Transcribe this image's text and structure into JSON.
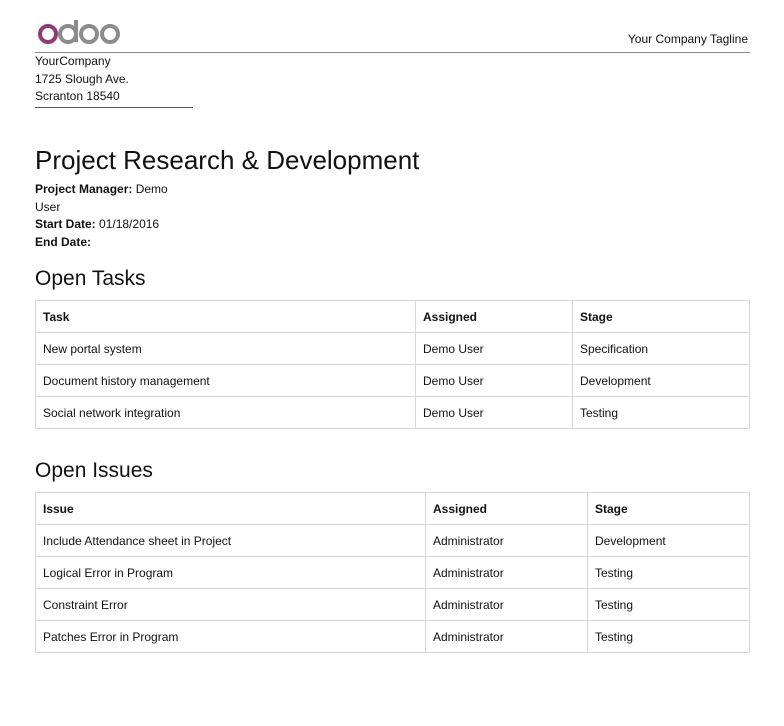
{
  "header": {
    "logo_text": "odoo",
    "tagline": "Your Company Tagline"
  },
  "company": {
    "name": "YourCompany",
    "street": "1725 Slough Ave.",
    "city_zip": "Scranton 18540"
  },
  "project": {
    "title": "Project Research & Development",
    "manager_label": "Project Manager:",
    "manager_value": "Demo User",
    "start_label": "Start Date:",
    "start_value": "01/18/2016",
    "end_label": "End Date:",
    "end_value": ""
  },
  "tasks": {
    "heading": "Open Tasks",
    "columns": [
      "Task",
      "Assigned",
      "Stage"
    ],
    "rows": [
      [
        "New portal system",
        "Demo User",
        "Specification"
      ],
      [
        "Document history management",
        "Demo User",
        "Development"
      ],
      [
        "Social network integration",
        "Demo User",
        "Testing"
      ]
    ]
  },
  "issues": {
    "heading": "Open Issues",
    "columns": [
      "Issue",
      "Assigned",
      "Stage"
    ],
    "rows": [
      [
        "Include Attendance sheet in Project",
        "Administrator",
        "Development"
      ],
      [
        "Logical Error in Program",
        "Administrator",
        "Testing"
      ],
      [
        "Constraint Error",
        "Administrator",
        "Testing"
      ],
      [
        "Patches Error in Program",
        "Administrator",
        "Testing"
      ]
    ]
  },
  "colors": {
    "logo_o": "#8f3b76",
    "logo_grey": "#8c8c8c"
  }
}
